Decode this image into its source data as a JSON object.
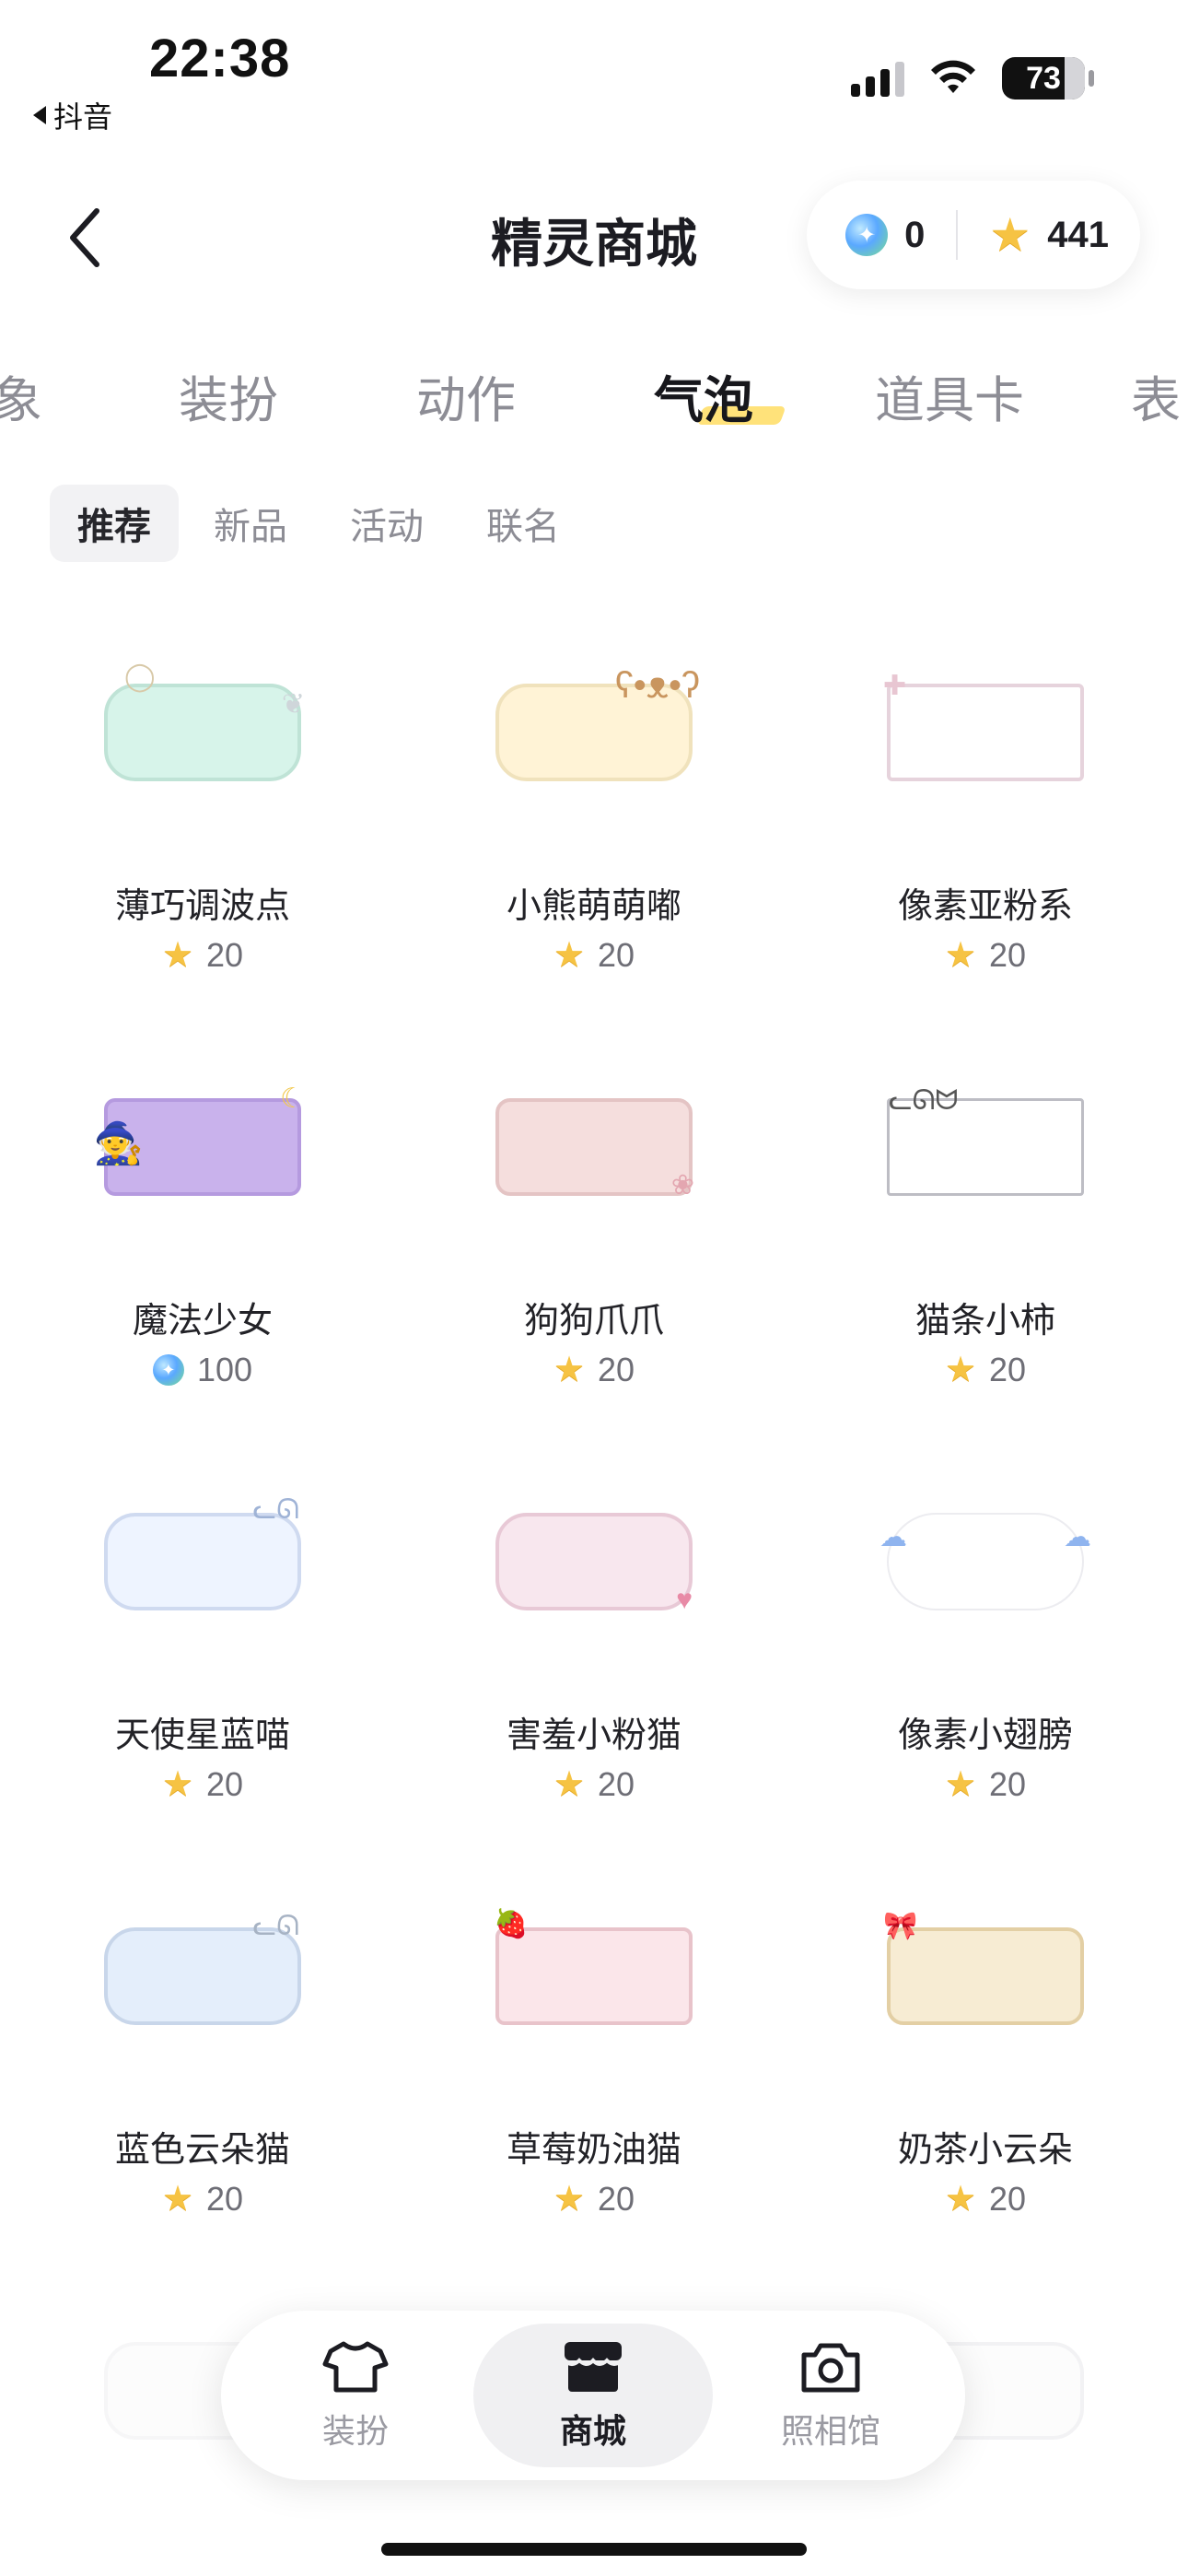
{
  "status_bar": {
    "time": "22:38",
    "back_app": "抖音",
    "battery": "73"
  },
  "header": {
    "title": "精灵商城",
    "gems": "0",
    "stars": "441"
  },
  "category_tabs": [
    "象",
    "装扮",
    "动作",
    "气泡",
    "道具卡",
    "表"
  ],
  "category_active": "气泡",
  "sub_tabs": [
    "推荐",
    "新品",
    "活动",
    "联名"
  ],
  "sub_active": "推荐",
  "items": [
    {
      "name": "薄巧调波点",
      "price": "20",
      "currency": "star",
      "color": "#d7f4ea"
    },
    {
      "name": "小熊萌萌嘟",
      "price": "20",
      "currency": "star",
      "color": "#fff3d6"
    },
    {
      "name": "像素亚粉系",
      "price": "20",
      "currency": "star",
      "color": "#ffffff"
    },
    {
      "name": "魔法少女",
      "price": "100",
      "currency": "gem",
      "color": "#c9b2ec"
    },
    {
      "name": "狗狗爪爪",
      "price": "20",
      "currency": "star",
      "color": "#f5dedd"
    },
    {
      "name": "猫条小柿",
      "price": "20",
      "currency": "star",
      "color": "#ffffff"
    },
    {
      "name": "天使星蓝喵",
      "price": "20",
      "currency": "star",
      "color": "#eef4ff"
    },
    {
      "name": "害羞小粉猫",
      "price": "20",
      "currency": "star",
      "color": "#f8e7ee"
    },
    {
      "name": "像素小翅膀",
      "price": "20",
      "currency": "star",
      "color": "#ffffff"
    },
    {
      "name": "蓝色云朵猫",
      "price": "20",
      "currency": "star",
      "color": "#e4eefb"
    },
    {
      "name": "草莓奶油猫",
      "price": "20",
      "currency": "star",
      "color": "#fbe6ea"
    },
    {
      "name": "奶茶小云朵",
      "price": "20",
      "currency": "star",
      "color": "#f7ecd3"
    }
  ],
  "bottom_nav": [
    {
      "label": "装扮",
      "icon": "tshirt-icon"
    },
    {
      "label": "商城",
      "icon": "store-icon"
    },
    {
      "label": "照相馆",
      "icon": "camera-icon"
    }
  ],
  "bottom_nav_active": "商城"
}
